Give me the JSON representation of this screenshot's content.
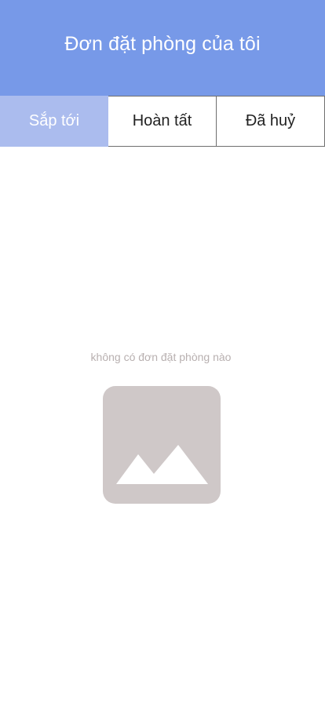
{
  "header": {
    "title": "Đơn đặt phòng của tôi"
  },
  "tabs": [
    {
      "label": "Sắp tới",
      "active": true
    },
    {
      "label": "Hoàn tất",
      "active": false
    },
    {
      "label": "Đã huỷ",
      "active": false
    }
  ],
  "empty_state": {
    "message": "không có đơn đặt phòng nào",
    "image_icon": "image-placeholder-icon"
  },
  "colors": {
    "header_bg": "#7799e8",
    "active_tab_bg": "#abbcee",
    "placeholder_bg": "#cfc8c8",
    "empty_text": "#b8b0b0"
  }
}
